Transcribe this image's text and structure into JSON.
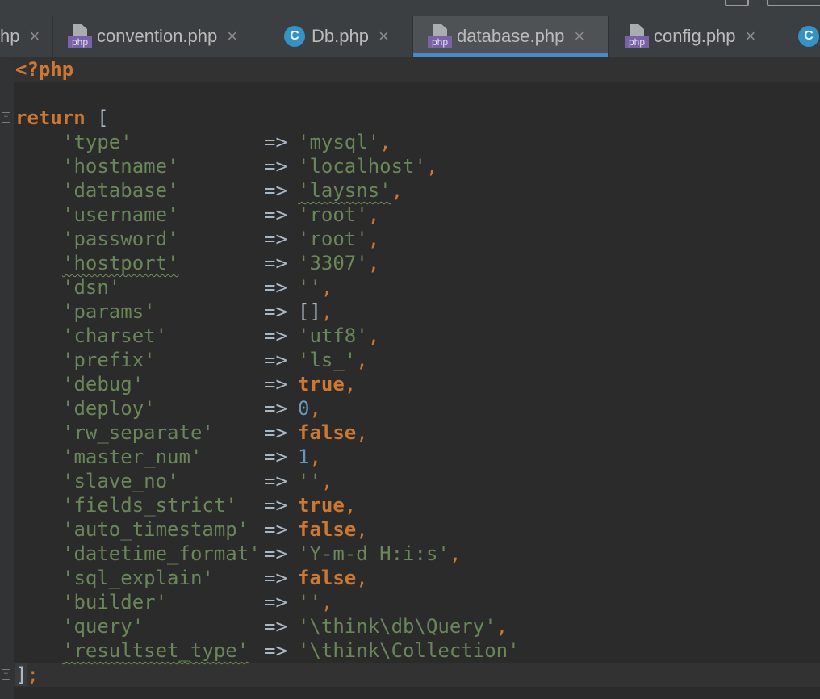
{
  "tabs": [
    {
      "label": "hp",
      "icon": "none",
      "active": false
    },
    {
      "label": "convention.php",
      "icon": "php-file-icon",
      "active": false
    },
    {
      "label": "Db.php",
      "icon": "class-icon",
      "active": false
    },
    {
      "label": "database.php",
      "icon": "php-file-icon",
      "active": true
    },
    {
      "label": "config.php",
      "icon": "php-file-icon",
      "active": false
    },
    {
      "label": "",
      "icon": "class-icon",
      "active": false
    }
  ],
  "icons": {
    "php_badge": "php",
    "class_letter": "C",
    "close": "×"
  },
  "colors": {
    "keyword": "#cc7832",
    "string": "#6a8759",
    "number": "#6897bb",
    "text": "#a9b7c6",
    "background": "#2b2b2b",
    "active_tab_underline": "#4a88c7"
  },
  "editor": {
    "open_tag": "<?php",
    "return_kw": "return",
    "open_bracket": " [",
    "arrow": "=>",
    "comma": ",",
    "close_bracket": "]",
    "semicolon": ";",
    "entries": [
      {
        "key": "'type'",
        "value": "'mysql'",
        "vtype": "str"
      },
      {
        "key": "'hostname'",
        "value": "'localhost'",
        "vtype": "str"
      },
      {
        "key": "'database'",
        "value": "'laysns'",
        "vtype": "str"
      },
      {
        "key": "'username'",
        "value": "'root'",
        "vtype": "str"
      },
      {
        "key": "'password'",
        "value": "'root'",
        "vtype": "str"
      },
      {
        "key": "'hostport'",
        "value": "'3307'",
        "vtype": "str"
      },
      {
        "key": "'dsn'",
        "value": "''",
        "vtype": "str"
      },
      {
        "key": "'params'",
        "value": "[]",
        "vtype": "plain"
      },
      {
        "key": "'charset'",
        "value": "'utf8'",
        "vtype": "str"
      },
      {
        "key": "'prefix'",
        "value": "'ls_'",
        "vtype": "str"
      },
      {
        "key": "'debug'",
        "value": "true",
        "vtype": "kw"
      },
      {
        "key": "'deploy'",
        "value": "0",
        "vtype": "num"
      },
      {
        "key": "'rw_separate'",
        "value": "false",
        "vtype": "kw"
      },
      {
        "key": "'master_num'",
        "value": "1",
        "vtype": "num"
      },
      {
        "key": "'slave_no'",
        "value": "''",
        "vtype": "str"
      },
      {
        "key": "'fields_strict'",
        "value": "true",
        "vtype": "kw"
      },
      {
        "key": "'auto_timestamp'",
        "value": "false",
        "vtype": "kw"
      },
      {
        "key": "'datetime_format'",
        "value": "'Y-m-d H:i:s'",
        "vtype": "str"
      },
      {
        "key": "'sql_explain'",
        "value": "false",
        "vtype": "kw"
      },
      {
        "key": "'builder'",
        "value": "''",
        "vtype": "str"
      },
      {
        "key": "'query'",
        "value": "'\\think\\db\\Query'",
        "vtype": "str"
      },
      {
        "key": "'resultset_type'",
        "value": "'\\think\\Collection'",
        "vtype": "str",
        "last": true
      }
    ]
  }
}
